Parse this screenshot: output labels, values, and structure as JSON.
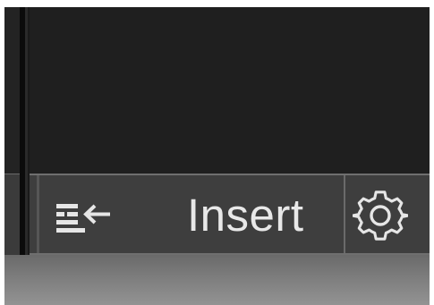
{
  "status_bar": {
    "indent_icon": "indent-arrow-icon",
    "mode_label": "Insert",
    "settings_icon": "gear-icon"
  },
  "colors": {
    "editor_background": "#1f1f1f",
    "status_bar_background": "#3e3e3e",
    "status_bar_border": "#6f6f6f",
    "label_text": "#e8e8e8",
    "bottom_strip": "#7d7d7d"
  }
}
